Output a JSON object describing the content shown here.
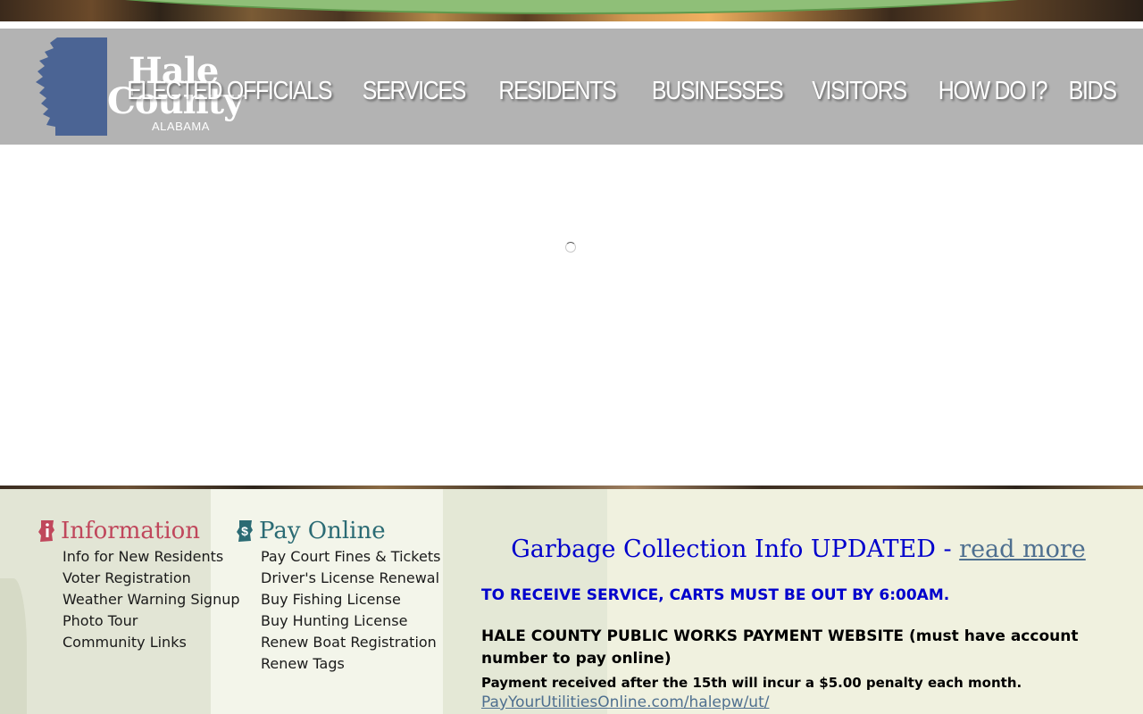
{
  "header": {
    "logo": {
      "line1": "Hale",
      "line2": "County",
      "line3": "ALABAMA"
    },
    "nav": [
      {
        "label": "ELECTED OFFICIALS"
      },
      {
        "label": "SERVICES"
      },
      {
        "label": "RESIDENTS"
      },
      {
        "label": "BUSINESSES"
      },
      {
        "label": "VISITORS"
      },
      {
        "label": "HOW DO I?"
      },
      {
        "label": "BIDS"
      }
    ]
  },
  "footer": {
    "information": {
      "title": "Information",
      "icon": "info-icon",
      "color": "#c0475c",
      "links": [
        "Info for New Residents",
        "Voter Registration",
        "Weather Warning Signup",
        "Photo Tour",
        "Community Links"
      ]
    },
    "pay_online": {
      "title": "Pay Online",
      "icon": "dollar-icon",
      "color": "#2b6b74",
      "links": [
        "Pay Court Fines & Tickets",
        "Driver's License Renewal",
        "Buy Fishing License",
        "Buy Hunting License",
        "Renew Boat Registration",
        "Renew Tags"
      ]
    },
    "news": {
      "headline": "Garbage Collection Info UPDATED - ",
      "read_more": "read more",
      "notice": "TO RECEIVE SERVICE, CARTS MUST BE OUT BY 6:00AM.",
      "payment_title": "HALE COUNTY PUBLIC WORKS PAYMENT WEBSITE (must have account number to pay online)",
      "penalty": "Payment received after the 15th will incur a $5.00 penalty each month.",
      "link": "PayYourUtilitiesOnline.com/halepw/ut/"
    }
  },
  "colors": {
    "header_bg": "#b3b3b3",
    "logo_blue": "#4b6494",
    "footer_bg": "#f0f1df",
    "headline_blue": "#0000cc",
    "link_slate": "#4e6f8f"
  }
}
